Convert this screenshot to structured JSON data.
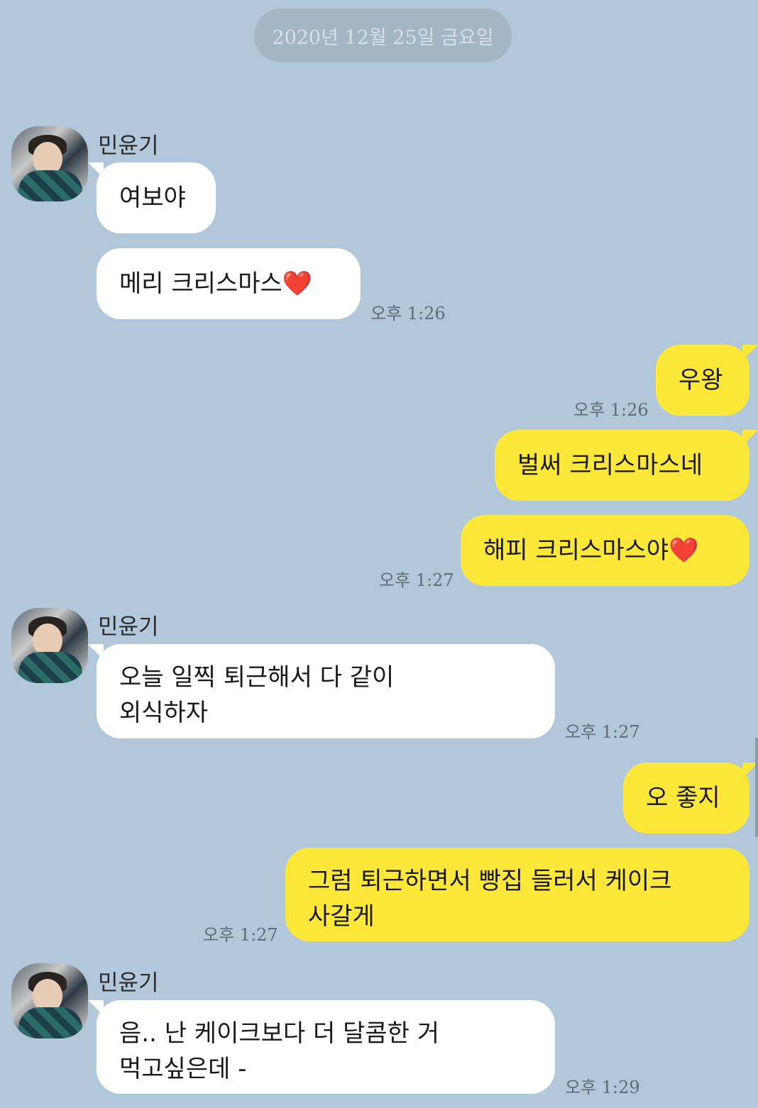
{
  "date_divider": "2020년 12월 25일 금요일",
  "contact": {
    "name": "민윤기"
  },
  "messages": [
    {
      "text": "여보야"
    },
    {
      "text": "메리 크리스마스",
      "emoji": "❤️",
      "time": "오후 1:26"
    },
    {
      "text": "우왕",
      "time": "오후 1:26"
    },
    {
      "text": "벌써 크리스마스네"
    },
    {
      "text": "해피 크리스마스야",
      "emoji": "❤️",
      "time": "오후 1:27"
    },
    {
      "line1": "오늘 일찍 퇴근해서 다 같이",
      "line2": "외식하자",
      "time": "오후 1:27"
    },
    {
      "text": "오 좋지"
    },
    {
      "line1": "그럼 퇴근하면서 빵집 들러서 케이크",
      "line2": "사갈게",
      "time": "오후 1:27"
    },
    {
      "line1": "음.. 난 케이크보다 더 달콤한 거",
      "line2": "먹고싶은데 -",
      "time": "오후 1:29"
    }
  ],
  "colors": {
    "background": "#b2c7da",
    "incoming_bubble": "#ffffff",
    "outgoing_bubble": "#fde83a",
    "date_pill": "#a4b5c4"
  }
}
